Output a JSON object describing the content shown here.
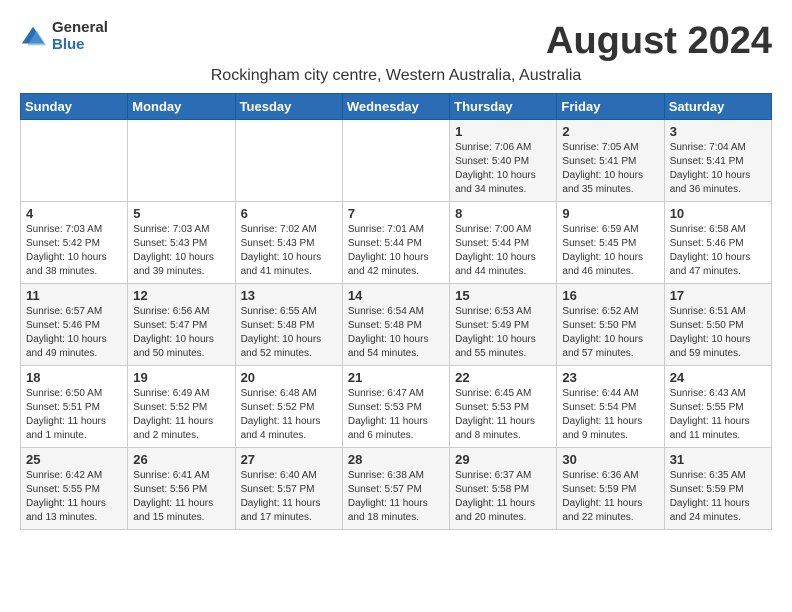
{
  "header": {
    "logo_general": "General",
    "logo_blue": "Blue",
    "month_title": "August 2024",
    "subtitle": "Rockingham city centre, Western Australia, Australia"
  },
  "days_of_week": [
    "Sunday",
    "Monday",
    "Tuesday",
    "Wednesday",
    "Thursday",
    "Friday",
    "Saturday"
  ],
  "weeks": [
    [
      {
        "day": "",
        "info": ""
      },
      {
        "day": "",
        "info": ""
      },
      {
        "day": "",
        "info": ""
      },
      {
        "day": "",
        "info": ""
      },
      {
        "day": "1",
        "info": "Sunrise: 7:06 AM\nSunset: 5:40 PM\nDaylight: 10 hours\nand 34 minutes."
      },
      {
        "day": "2",
        "info": "Sunrise: 7:05 AM\nSunset: 5:41 PM\nDaylight: 10 hours\nand 35 minutes."
      },
      {
        "day": "3",
        "info": "Sunrise: 7:04 AM\nSunset: 5:41 PM\nDaylight: 10 hours\nand 36 minutes."
      }
    ],
    [
      {
        "day": "4",
        "info": "Sunrise: 7:03 AM\nSunset: 5:42 PM\nDaylight: 10 hours\nand 38 minutes."
      },
      {
        "day": "5",
        "info": "Sunrise: 7:03 AM\nSunset: 5:43 PM\nDaylight: 10 hours\nand 39 minutes."
      },
      {
        "day": "6",
        "info": "Sunrise: 7:02 AM\nSunset: 5:43 PM\nDaylight: 10 hours\nand 41 minutes."
      },
      {
        "day": "7",
        "info": "Sunrise: 7:01 AM\nSunset: 5:44 PM\nDaylight: 10 hours\nand 42 minutes."
      },
      {
        "day": "8",
        "info": "Sunrise: 7:00 AM\nSunset: 5:44 PM\nDaylight: 10 hours\nand 44 minutes."
      },
      {
        "day": "9",
        "info": "Sunrise: 6:59 AM\nSunset: 5:45 PM\nDaylight: 10 hours\nand 46 minutes."
      },
      {
        "day": "10",
        "info": "Sunrise: 6:58 AM\nSunset: 5:46 PM\nDaylight: 10 hours\nand 47 minutes."
      }
    ],
    [
      {
        "day": "11",
        "info": "Sunrise: 6:57 AM\nSunset: 5:46 PM\nDaylight: 10 hours\nand 49 minutes."
      },
      {
        "day": "12",
        "info": "Sunrise: 6:56 AM\nSunset: 5:47 PM\nDaylight: 10 hours\nand 50 minutes."
      },
      {
        "day": "13",
        "info": "Sunrise: 6:55 AM\nSunset: 5:48 PM\nDaylight: 10 hours\nand 52 minutes."
      },
      {
        "day": "14",
        "info": "Sunrise: 6:54 AM\nSunset: 5:48 PM\nDaylight: 10 hours\nand 54 minutes."
      },
      {
        "day": "15",
        "info": "Sunrise: 6:53 AM\nSunset: 5:49 PM\nDaylight: 10 hours\nand 55 minutes."
      },
      {
        "day": "16",
        "info": "Sunrise: 6:52 AM\nSunset: 5:50 PM\nDaylight: 10 hours\nand 57 minutes."
      },
      {
        "day": "17",
        "info": "Sunrise: 6:51 AM\nSunset: 5:50 PM\nDaylight: 10 hours\nand 59 minutes."
      }
    ],
    [
      {
        "day": "18",
        "info": "Sunrise: 6:50 AM\nSunset: 5:51 PM\nDaylight: 11 hours\nand 1 minute."
      },
      {
        "day": "19",
        "info": "Sunrise: 6:49 AM\nSunset: 5:52 PM\nDaylight: 11 hours\nand 2 minutes."
      },
      {
        "day": "20",
        "info": "Sunrise: 6:48 AM\nSunset: 5:52 PM\nDaylight: 11 hours\nand 4 minutes."
      },
      {
        "day": "21",
        "info": "Sunrise: 6:47 AM\nSunset: 5:53 PM\nDaylight: 11 hours\nand 6 minutes."
      },
      {
        "day": "22",
        "info": "Sunrise: 6:45 AM\nSunset: 5:53 PM\nDaylight: 11 hours\nand 8 minutes."
      },
      {
        "day": "23",
        "info": "Sunrise: 6:44 AM\nSunset: 5:54 PM\nDaylight: 11 hours\nand 9 minutes."
      },
      {
        "day": "24",
        "info": "Sunrise: 6:43 AM\nSunset: 5:55 PM\nDaylight: 11 hours\nand 11 minutes."
      }
    ],
    [
      {
        "day": "25",
        "info": "Sunrise: 6:42 AM\nSunset: 5:55 PM\nDaylight: 11 hours\nand 13 minutes."
      },
      {
        "day": "26",
        "info": "Sunrise: 6:41 AM\nSunset: 5:56 PM\nDaylight: 11 hours\nand 15 minutes."
      },
      {
        "day": "27",
        "info": "Sunrise: 6:40 AM\nSunset: 5:57 PM\nDaylight: 11 hours\nand 17 minutes."
      },
      {
        "day": "28",
        "info": "Sunrise: 6:38 AM\nSunset: 5:57 PM\nDaylight: 11 hours\nand 18 minutes."
      },
      {
        "day": "29",
        "info": "Sunrise: 6:37 AM\nSunset: 5:58 PM\nDaylight: 11 hours\nand 20 minutes."
      },
      {
        "day": "30",
        "info": "Sunrise: 6:36 AM\nSunset: 5:59 PM\nDaylight: 11 hours\nand 22 minutes."
      },
      {
        "day": "31",
        "info": "Sunrise: 6:35 AM\nSunset: 5:59 PM\nDaylight: 11 hours\nand 24 minutes."
      }
    ]
  ]
}
